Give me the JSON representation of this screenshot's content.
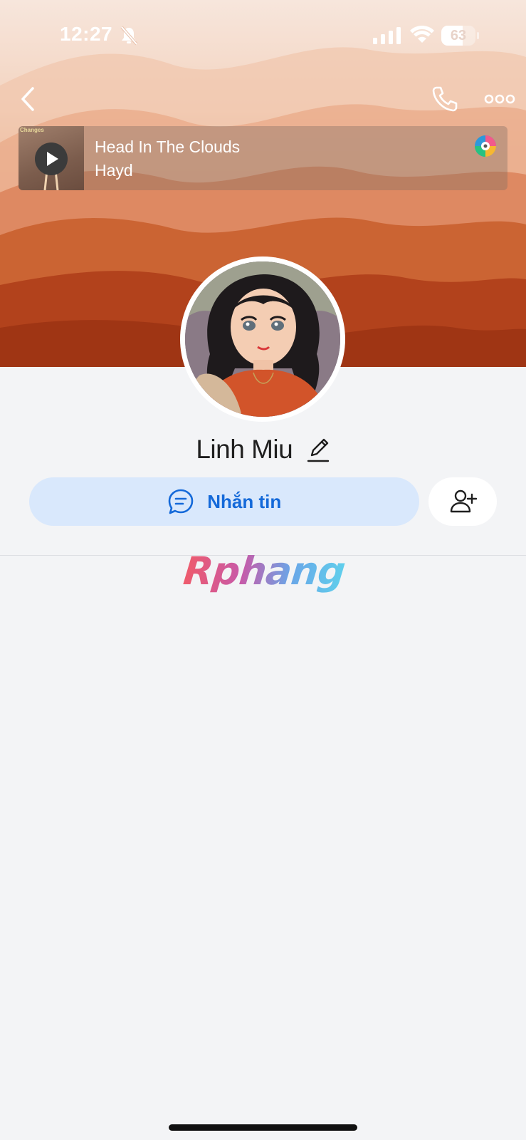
{
  "status_bar": {
    "time": "12:27",
    "battery_percent": "63",
    "battery_level": 0.63,
    "icons": [
      "bell-slash-icon",
      "cellular-signal-icon",
      "wifi-icon",
      "battery-icon"
    ]
  },
  "header": {
    "icons": [
      "chevron-left-icon",
      "phone-icon",
      "more-dots-icon"
    ]
  },
  "music": {
    "cover_label": "Changes",
    "title": "Head In The Clouds",
    "artist": "Hayd",
    "icons": [
      "play-icon",
      "music-disc-icon"
    ]
  },
  "profile": {
    "name": "Linh Miu",
    "edit_icon": "pencil-icon"
  },
  "actions": {
    "message_label": "Nhắn tin",
    "message_icon": "chat-bubble-icon",
    "add_friend_icon": "add-user-icon"
  },
  "watermark": {
    "text": "Rphang"
  },
  "colors": {
    "accent": "#1469d9",
    "message_button_bg": "#d9e8fc",
    "page_bg": "#f3f4f6"
  }
}
